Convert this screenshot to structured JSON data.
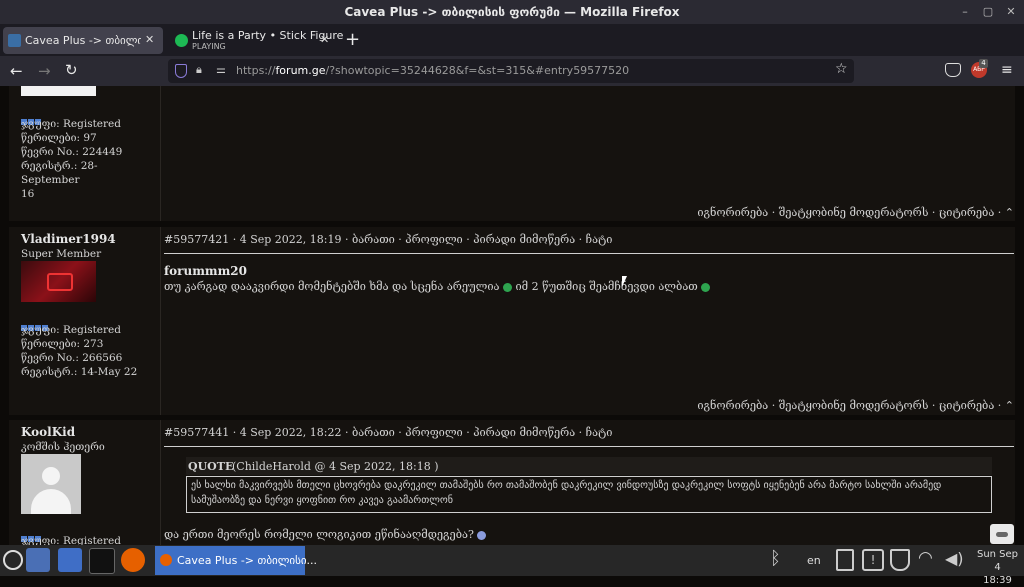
{
  "window": {
    "title": "Cavea Plus -> თბილისის ფორუმი — Mozilla Firefox"
  },
  "tabs": [
    {
      "label": "Cavea Plus -> თბილისის ფ"
    },
    {
      "label": "Life is a Party • Stick Figure",
      "sublabel": "PLAYING"
    }
  ],
  "nav": {
    "url_prefix": "https://",
    "url_domain": "forum.ge",
    "url_path": "/?showtopic=35244628&f=&st=315&#entry59577520",
    "badge_count": "4"
  },
  "posts": [
    {
      "group": "ჯგუფი: Registered",
      "post_count": "წერილები: 97",
      "member_no": "წევრი No.: 224449",
      "registered": "რეგისტრ.: 28-September",
      "registered_cont": "16",
      "actions": "იგნორირება · შეატყობინე მოდერატორს  · ციტირება · ⌃"
    },
    {
      "author": "Vladimer1994",
      "rank": "Super Member",
      "group": "ჯგუფი: Registered",
      "post_count": "წერილები: 273",
      "member_no": "წევრი No.: 266566",
      "registered": "რეგისტრ.: 14-May 22",
      "meta": "#59577421 · 4 Sep 2022, 18:19 · ბარათი · პროფილი · პირადი მიმოწერა · ჩატი",
      "quote_name": "forummm20",
      "body_a": "თუ კარგად დააკვირდი მომენტებში ხმა და სცენა არეულია",
      "body_b": "იმ 2 წუთშიც შეამჩნევდი ალბათ",
      "actions": "იგნორირება · შეატყობინე მოდერატორს  · ციტირება · ⌃"
    },
    {
      "author": "KoolKid",
      "rank": "კომშის ჰეთერი",
      "group": "ჯგუფი: Registered",
      "meta": "#59577441 · 4 Sep 2022, 18:22 · ბარათი · პროფილი · პირადი მიმოწერა · ჩატი",
      "quote_header": "QUOTE",
      "quote_source": "(ChildeHarold @ 4 Sep 2022, 18:18 )",
      "quote_text": "ეს ხალხი მაკვირვებს მთელი ცხოვრება დაკრეკილ თამაშებს რო თამაშობენ დაკრეკილ ვინდოუსზე დაკრეკილ სოფტს იყენებენ არა მარტო სახლში არამედ სამუშაობზე და ნერვი ყოფნით რო კავეა გაამართლონ",
      "body": "და ერთი მეორეს რომელი ლოგიკით ეწინააღმდეგება?"
    }
  ],
  "taskbar": {
    "active_window": "Cavea Plus -> თბილისი...",
    "lang": "en",
    "clock_date": "Sun Sep  4",
    "clock_time": "18:39"
  },
  "colors": {
    "accent": "#4f7fd0",
    "page_bg": "#0c0a08",
    "post_bg": "#15120f"
  }
}
